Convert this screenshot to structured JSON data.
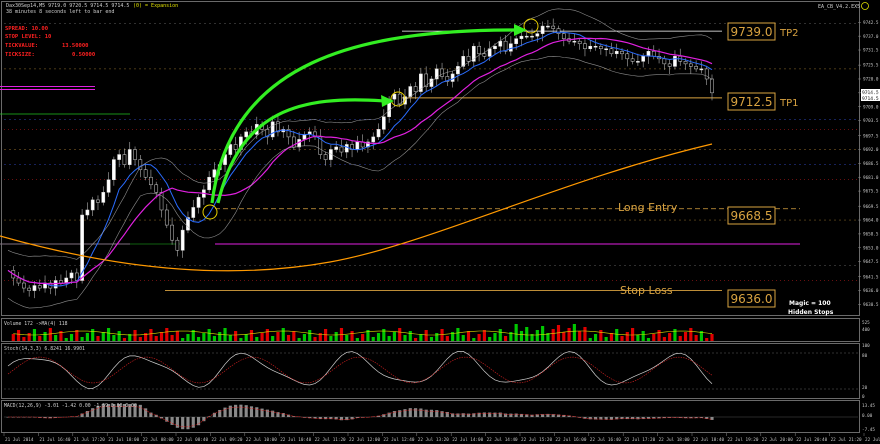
{
  "header": {
    "symbol_line": "Dax30Sep14,M5  9719.0 9720.5 9714.5 9714.5",
    "subtitle": "38 minutes 8 seconds left to bar end",
    "expansion_label": "(0) = Expansion",
    "ea_label": "EA_CB_V4.2.EX5"
  },
  "info_panel": {
    "spread_label": "SPREAD: 10.00",
    "stop_level_label": "STOP LEVEL: 10",
    "tick_value_label": "TICKVALUE:",
    "tick_value": "13.50000",
    "tick_size_label": "TICKSIZE:",
    "tick_size": "0.50000"
  },
  "levels": {
    "tp2": {
      "price": "9739.0",
      "label": "TP2"
    },
    "tp1": {
      "price": "9712.5",
      "label": "TP1"
    },
    "entry": {
      "price": "9668.5",
      "label": "Long Entry"
    },
    "stop": {
      "price": "9636.0",
      "label": "Stop Loss"
    }
  },
  "magic_label": "Magic = 100",
  "hidden_stops_label": "Hidden Stops",
  "current_price_tags": [
    "9714.5",
    "9714.5"
  ],
  "panels": {
    "volume_label": "Volume 172  ->MA(4) 118",
    "stoch_label": "Stoch(14,3,3) 6.8241 16.9901",
    "macd_label": "MACD(12,26,9) -3.01 -1.42 0.00 -1.59 0.00 0.00"
  },
  "colors": {
    "bull": "#00c800",
    "bear": "#e00000",
    "wick": "#b0b0b0",
    "ma_fast": "#2a6cff",
    "ma_magenta": "#e020e0",
    "ma_slow": "#ff9900",
    "level_line": "#d9a341",
    "arrow": "#33ee22",
    "bands": "#b0b0b0"
  },
  "chart_data": {
    "type": "candlestick",
    "instrument": "Dax30Sep14",
    "timeframe": "M5",
    "y_axis_main": {
      "ylim": [
        9627.5,
        9745.0
      ],
      "ticks": [
        "9742.5",
        "9737.0",
        "9731.5",
        "9725.5",
        "9720.0",
        "9714.5",
        "9709.0",
        "9703.5",
        "9697.5",
        "9692.0",
        "9686.5",
        "9681.0",
        "9675.5",
        "9669.5",
        "9664.0",
        "9658.5",
        "9653.0",
        "9647.5",
        "9641.5",
        "9636.0",
        "9630.5"
      ]
    },
    "x_axis_labels": [
      "21 Jul 2014",
      "21 Jul 16:40",
      "21 Jul 17:20",
      "21 Jul 18:00",
      "22 Jul 08:00",
      "22 Jul 08:40",
      "22 Jul 09:20",
      "22 Jul 10:00",
      "22 Jul 10:40",
      "22 Jul 11:20",
      "22 Jul 12:00",
      "22 Jul 12:40",
      "22 Jul 13:20",
      "22 Jul 14:00",
      "22 Jul 14:40",
      "22 Jul 15:20",
      "22 Jul 16:00",
      "22 Jul 16:40",
      "22 Jul 17:20",
      "22 Jul 18:00",
      "22 Jul 18:40",
      "22 Jul 19:20",
      "22 Jul 20:00",
      "22 Jul 20:40",
      "22 Jul 21:20",
      "22 Jul 22:00"
    ],
    "close_series": [
      9644,
      9641,
      9639,
      9637,
      9636,
      9638,
      9637,
      9639,
      9637,
      9640,
      9639,
      9641,
      9643,
      9640,
      9666,
      9668,
      9672,
      9671,
      9675,
      9680,
      9688,
      9690,
      9686,
      9692,
      9688,
      9684,
      9681,
      9678,
      9675,
      9668,
      9662,
      9656,
      9652,
      9660,
      9665,
      9669,
      9673,
      9676,
      9681,
      9684,
      9686,
      9690,
      9694,
      9692,
      9697,
      9699,
      9698,
      9702,
      9700,
      9697,
      9703,
      9699,
      9700,
      9697,
      9693,
      9696,
      9698,
      9699,
      9697,
      9690,
      9688,
      9692,
      9693,
      9691,
      9694,
      9692,
      9695,
      9693,
      9695,
      9697,
      9700,
      9705,
      9712,
      9714,
      9710,
      9713,
      9717,
      9715,
      9722,
      9717,
      9720,
      9724,
      9721,
      9719,
      9722,
      9725,
      9729,
      9727,
      9733,
      9730,
      9729,
      9732,
      9733,
      9735,
      9731,
      9734,
      9736,
      9737,
      9737,
      9737,
      9738,
      9741,
      9741,
      9740,
      9738,
      9736,
      9735,
      9735,
      9734,
      9732,
      9733,
      9733,
      9732,
      9732,
      9730,
      9731,
      9730,
      9728,
      9727,
      9727,
      9729,
      9731,
      9729,
      9728,
      9726,
      9725,
      9729,
      9727,
      9726,
      9725,
      9724,
      9724,
      9720,
      9714.5
    ],
    "volume_scale": [
      "525",
      "400"
    ],
    "stoch_scale": [
      "100",
      "80",
      "20",
      "0"
    ],
    "macd_scale": [
      "13.45",
      "0.00",
      "-7.45"
    ]
  }
}
